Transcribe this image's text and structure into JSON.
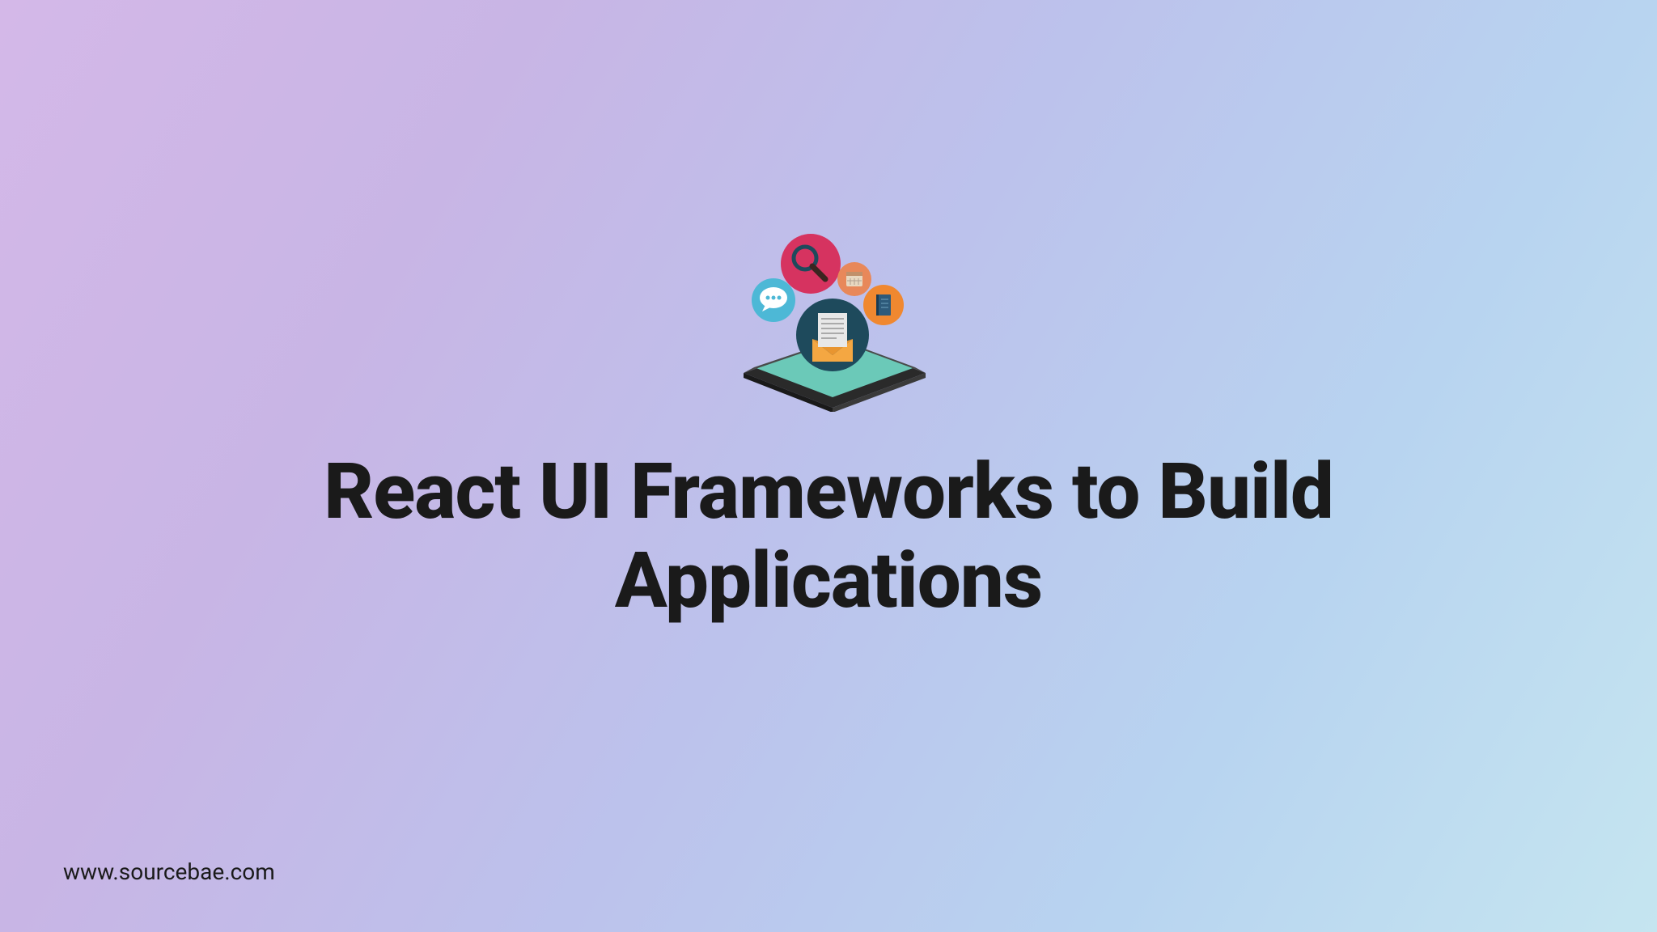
{
  "title": "React UI Frameworks to Build Applications",
  "footer_url": "www.sourcebae.com"
}
